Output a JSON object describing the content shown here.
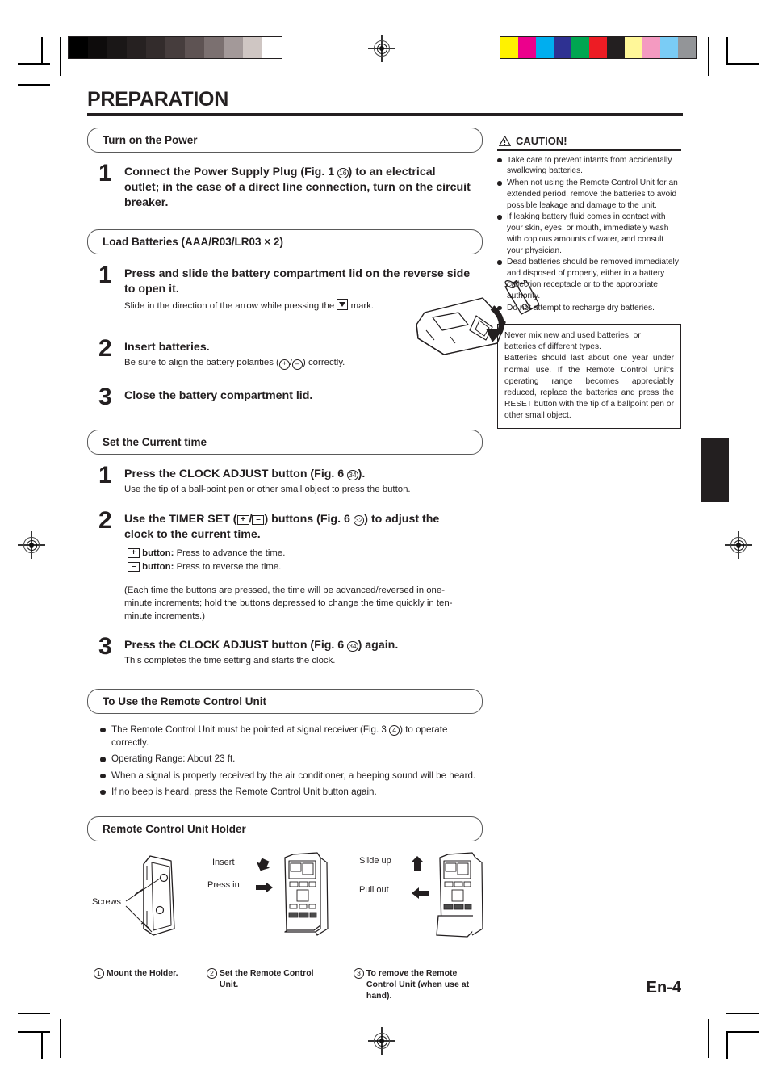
{
  "document": {
    "title": "PREPARATION",
    "page_number": "En-4"
  },
  "sections": {
    "power": {
      "heading": "Turn on the Power",
      "steps": [
        {
          "num": "1",
          "text_a": "Connect the Power Supply Plug (Fig. 1 ",
          "ref": "16",
          "text_b": ") to an electrical outlet; in the case of a direct line connection, turn on the circuit breaker."
        }
      ]
    },
    "batteries": {
      "heading": "Load Batteries (AAA/R03/LR03 × 2)",
      "step1_head": "Press and slide the battery compartment lid on the reverse side to open it.",
      "step1_sub_a": "Slide in the direction of the arrow while pressing the",
      "step1_sub_b": "mark.",
      "step2_head": "Insert batteries.",
      "step2_sub_a": "Be sure to align the battery polarities (",
      "step2_plus": "+",
      "step2_slash": "/",
      "step2_minus": "–",
      "step2_sub_b": ") correctly.",
      "step3_head": "Close the battery compartment lid.",
      "nums": [
        "1",
        "2",
        "3"
      ]
    },
    "clock": {
      "heading": "Set the Current time",
      "step1_num": "1",
      "step1_head_a": "Press the CLOCK ADJUST button (Fig. 6 ",
      "step1_ref": "34",
      "step1_head_b": ").",
      "step1_sub": "Use the tip of a ball-point pen or other small object to press the button.",
      "step2_num": "2",
      "step2_head_a": "Use the TIMER SET (",
      "step2_key_plus": "+",
      "step2_head_mid": "/",
      "step2_key_minus": "–",
      "step2_head_b": ") buttons (Fig. 6 ",
      "step2_ref": "32",
      "step2_head_c": ") to adjust the clock to the current time.",
      "plus_label": "button:",
      "plus_desc": "Press to advance the time.",
      "minus_label": "button:",
      "minus_desc": "Press to reverse the time.",
      "note": "(Each time the buttons are pressed, the time will be advanced/reversed in one-minute increments; hold the buttons depressed to change the time quickly in ten-minute increments.)",
      "step3_num": "3",
      "step3_head_a": "Press the CLOCK ADJUST button  (Fig. 6 ",
      "step3_ref": "34",
      "step3_head_b": ") again.",
      "step3_sub": "This completes the time setting and starts the clock."
    },
    "use_remote": {
      "heading": "To Use the Remote Control Unit",
      "bullets": [
        {
          "a": "The Remote Control Unit must be pointed at signal receiver (Fig. 3 ",
          "ref": "4",
          "b": ") to operate correctly."
        },
        {
          "a": "Operating Range: About 23 ft.",
          "ref": "",
          "b": ""
        },
        {
          "a": "When a signal is properly received by the air conditioner, a beeping sound will be heard.",
          "ref": "",
          "b": ""
        },
        {
          "a": "If no beep is heard, press the Remote Control Unit button again.",
          "ref": "",
          "b": ""
        }
      ]
    },
    "holder": {
      "heading": "Remote Control Unit Holder",
      "figures": [
        {
          "number": "1",
          "caption": "Mount the Holder.",
          "labels": [
            "Screws"
          ]
        },
        {
          "number": "2",
          "caption": "Set the Remote Control Unit.",
          "labels": [
            "Insert",
            "Press in"
          ]
        },
        {
          "number": "3",
          "caption": "To remove the Remote Control Unit (when use at hand).",
          "labels": [
            "Slide up",
            "Pull out"
          ]
        }
      ]
    }
  },
  "caution": {
    "title": "CAUTION!",
    "icon": "warning-triangle-icon",
    "items": [
      "Take care to prevent infants from accidentally swallowing batteries.",
      "When not using the Remote Control Unit for an extended period, remove the batteries to avoid possible leakage and damage to the unit.",
      "If leaking battery fluid comes in contact with your skin, eyes, or mouth, immediately wash with copious amounts of water, and consult your physician.",
      "Dead batteries should be removed immediately and disposed of properly, either in a battery collection receptacle or to the appropriate authority.",
      "Do not attempt to recharge dry batteries."
    ],
    "note_box": [
      "Never mix new and used batteries, or batteries of different types.",
      "Batteries should last about one year under normal use. If the Remote Control Unit's operating range becomes appreciably reduced, replace the batteries and press the RESET button with the tip of a ballpoint pen or other small object."
    ]
  },
  "print_marks": {
    "gray_bar": [
      "#000000",
      "#0e0c0c",
      "#1a1717",
      "#262121",
      "#332c2c",
      "#463d3d",
      "#5e5353",
      "#7b7070",
      "#a39999",
      "#cfc6c3",
      "#ffffff"
    ],
    "color_bar": [
      "#fff200",
      "#ec008c",
      "#00aeef",
      "#2e3192",
      "#00a651",
      "#ed1c24",
      "#231f20",
      "#fff799",
      "#f49ac1",
      "#7accf5",
      "#939598"
    ],
    "thumb_tab_color": "#231f20"
  }
}
